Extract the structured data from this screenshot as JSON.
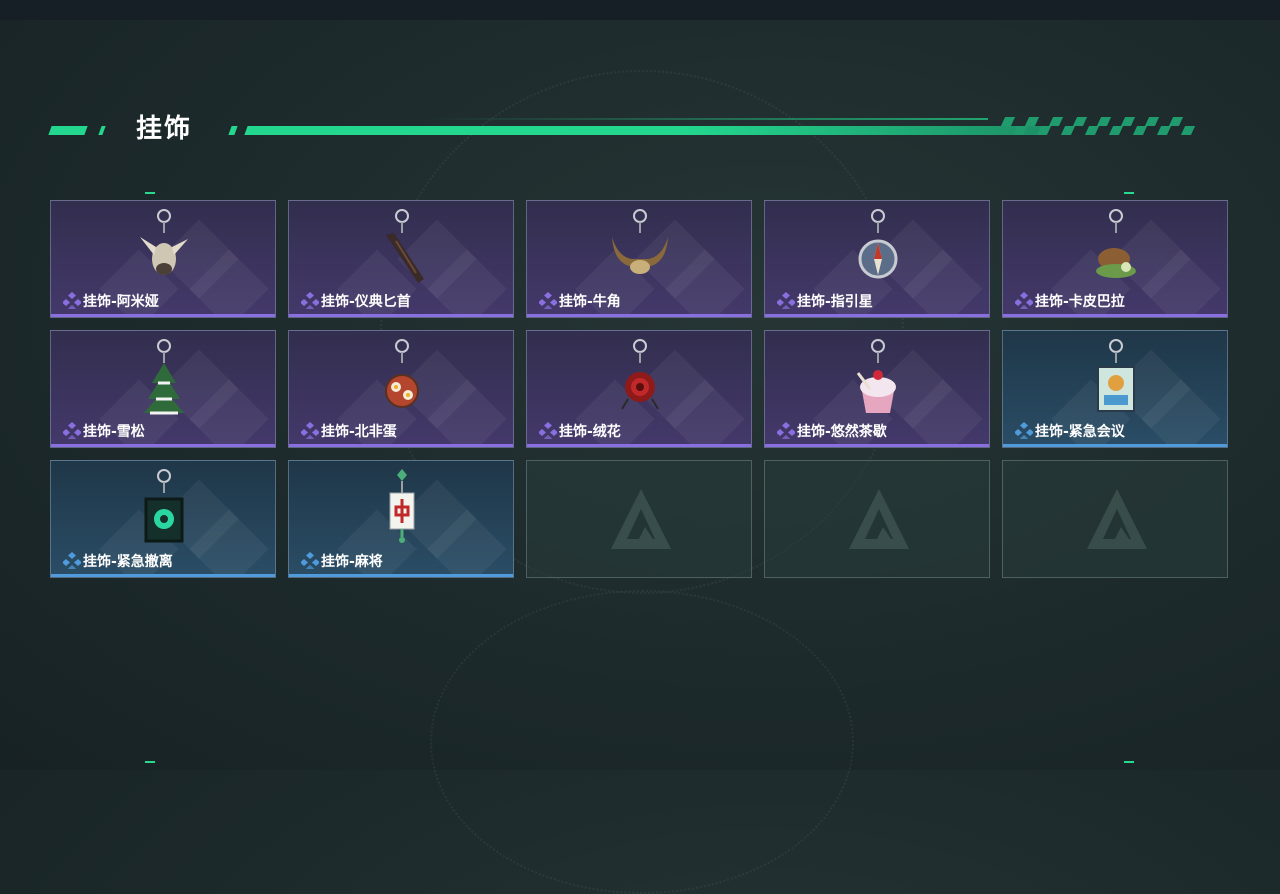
{
  "header": {
    "title": "挂饰"
  },
  "colors": {
    "accent": "#23d78e",
    "purple_rarity": "#8a6fe0",
    "blue_rarity": "#4f9bdc"
  },
  "items": [
    {
      "label": "挂饰-阿米娅",
      "rarity": "purple",
      "icon": "rabbit-charm-icon"
    },
    {
      "label": "挂饰-仪典匕首",
      "rarity": "purple",
      "icon": "dagger-charm-icon"
    },
    {
      "label": "挂饰-牛角",
      "rarity": "purple",
      "icon": "bull-horns-charm-icon"
    },
    {
      "label": "挂饰-指引星",
      "rarity": "purple",
      "icon": "compass-charm-icon"
    },
    {
      "label": "挂饰-卡皮巴拉",
      "rarity": "purple",
      "icon": "capybara-charm-icon"
    },
    {
      "label": "挂饰-雪松",
      "rarity": "purple",
      "icon": "pine-tree-charm-icon"
    },
    {
      "label": "挂饰-北非蛋",
      "rarity": "purple",
      "icon": "shakshuka-charm-icon"
    },
    {
      "label": "挂饰-绒花",
      "rarity": "purple",
      "icon": "velvet-flower-charm-icon"
    },
    {
      "label": "挂饰-悠然茶歇",
      "rarity": "purple",
      "icon": "cupcake-charm-icon"
    },
    {
      "label": "挂饰-紧急会议",
      "rarity": "blue",
      "icon": "meeting-badge-charm-icon"
    },
    {
      "label": "挂饰-紧急撤离",
      "rarity": "blue",
      "icon": "evacuation-charm-icon"
    },
    {
      "label": "挂饰-麻将",
      "rarity": "blue",
      "icon": "mahjong-tile-charm-icon"
    },
    {
      "label": "",
      "rarity": "empty",
      "icon": "empty-slot-logo-icon"
    },
    {
      "label": "",
      "rarity": "empty",
      "icon": "empty-slot-logo-icon"
    },
    {
      "label": "",
      "rarity": "empty",
      "icon": "empty-slot-logo-icon"
    }
  ]
}
